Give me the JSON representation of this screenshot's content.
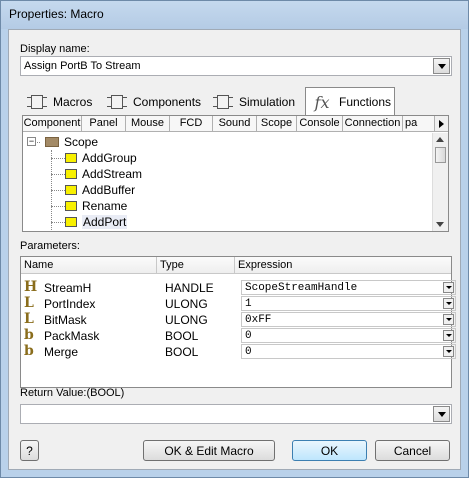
{
  "window": {
    "title": "Properties: Macro"
  },
  "display_name": {
    "label": "Display name:",
    "value": "Assign PortB To Stream"
  },
  "tabs": [
    {
      "label": "Macros",
      "icon": "macros-icon"
    },
    {
      "label": "Components",
      "icon": "components-icon"
    },
    {
      "label": "Simulation",
      "icon": "simulation-icon"
    },
    {
      "label": "Functions",
      "icon": "functions-icon"
    }
  ],
  "subtabs": [
    "Component",
    "Panel",
    "Mouse",
    "FCD",
    "Sound",
    "Scope",
    "Console",
    "Connection",
    "pa"
  ],
  "tree": {
    "root": "Scope",
    "items": [
      "AddGroup",
      "AddStream",
      "AddBuffer",
      "Rename",
      "AddPort"
    ],
    "selected": "AddPort"
  },
  "parameters": {
    "label": "Parameters:",
    "columns": [
      "Name",
      "Type",
      "Expression"
    ],
    "rows": [
      {
        "icon": "H",
        "name": "StreamH",
        "type": "HANDLE",
        "expression": "ScopeStreamHandle"
      },
      {
        "icon": "L",
        "name": "PortIndex",
        "type": "ULONG",
        "expression": "1"
      },
      {
        "icon": "L",
        "name": "BitMask",
        "type": "ULONG",
        "expression": "0xFF"
      },
      {
        "icon": "b",
        "name": "PackMask",
        "type": "BOOL",
        "expression": "0"
      },
      {
        "icon": "b",
        "name": "Merge",
        "type": "BOOL",
        "expression": "0"
      }
    ]
  },
  "return_value": {
    "label": "Return Value:(BOOL)",
    "value": ""
  },
  "buttons": {
    "help": "?",
    "ok_edit": "OK & Edit Macro",
    "ok": "OK",
    "cancel": "Cancel"
  }
}
